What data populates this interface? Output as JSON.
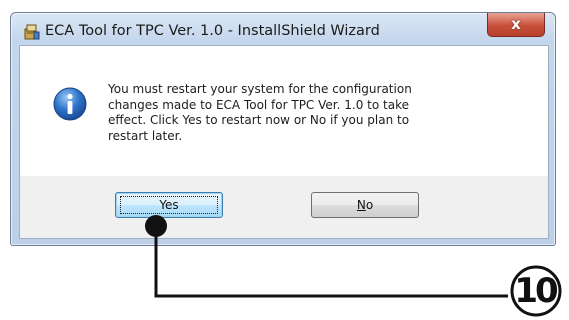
{
  "window": {
    "title": "ECA Tool for TPC Ver. 1.0 - InstallShield Wizard",
    "close_label": "x",
    "title_icon": "installer-icon"
  },
  "dialog": {
    "icon": "info-icon",
    "message": "You must restart your system for the configuration\nchanges made to ECA Tool for TPC Ver. 1.0 to take\neffect. Click Yes to restart now or No if you plan to\nrestart later.",
    "yes_label": "Yes",
    "no_label_underlined": "N",
    "no_label_rest": "o"
  },
  "annotation": {
    "callout_number": "10"
  }
}
